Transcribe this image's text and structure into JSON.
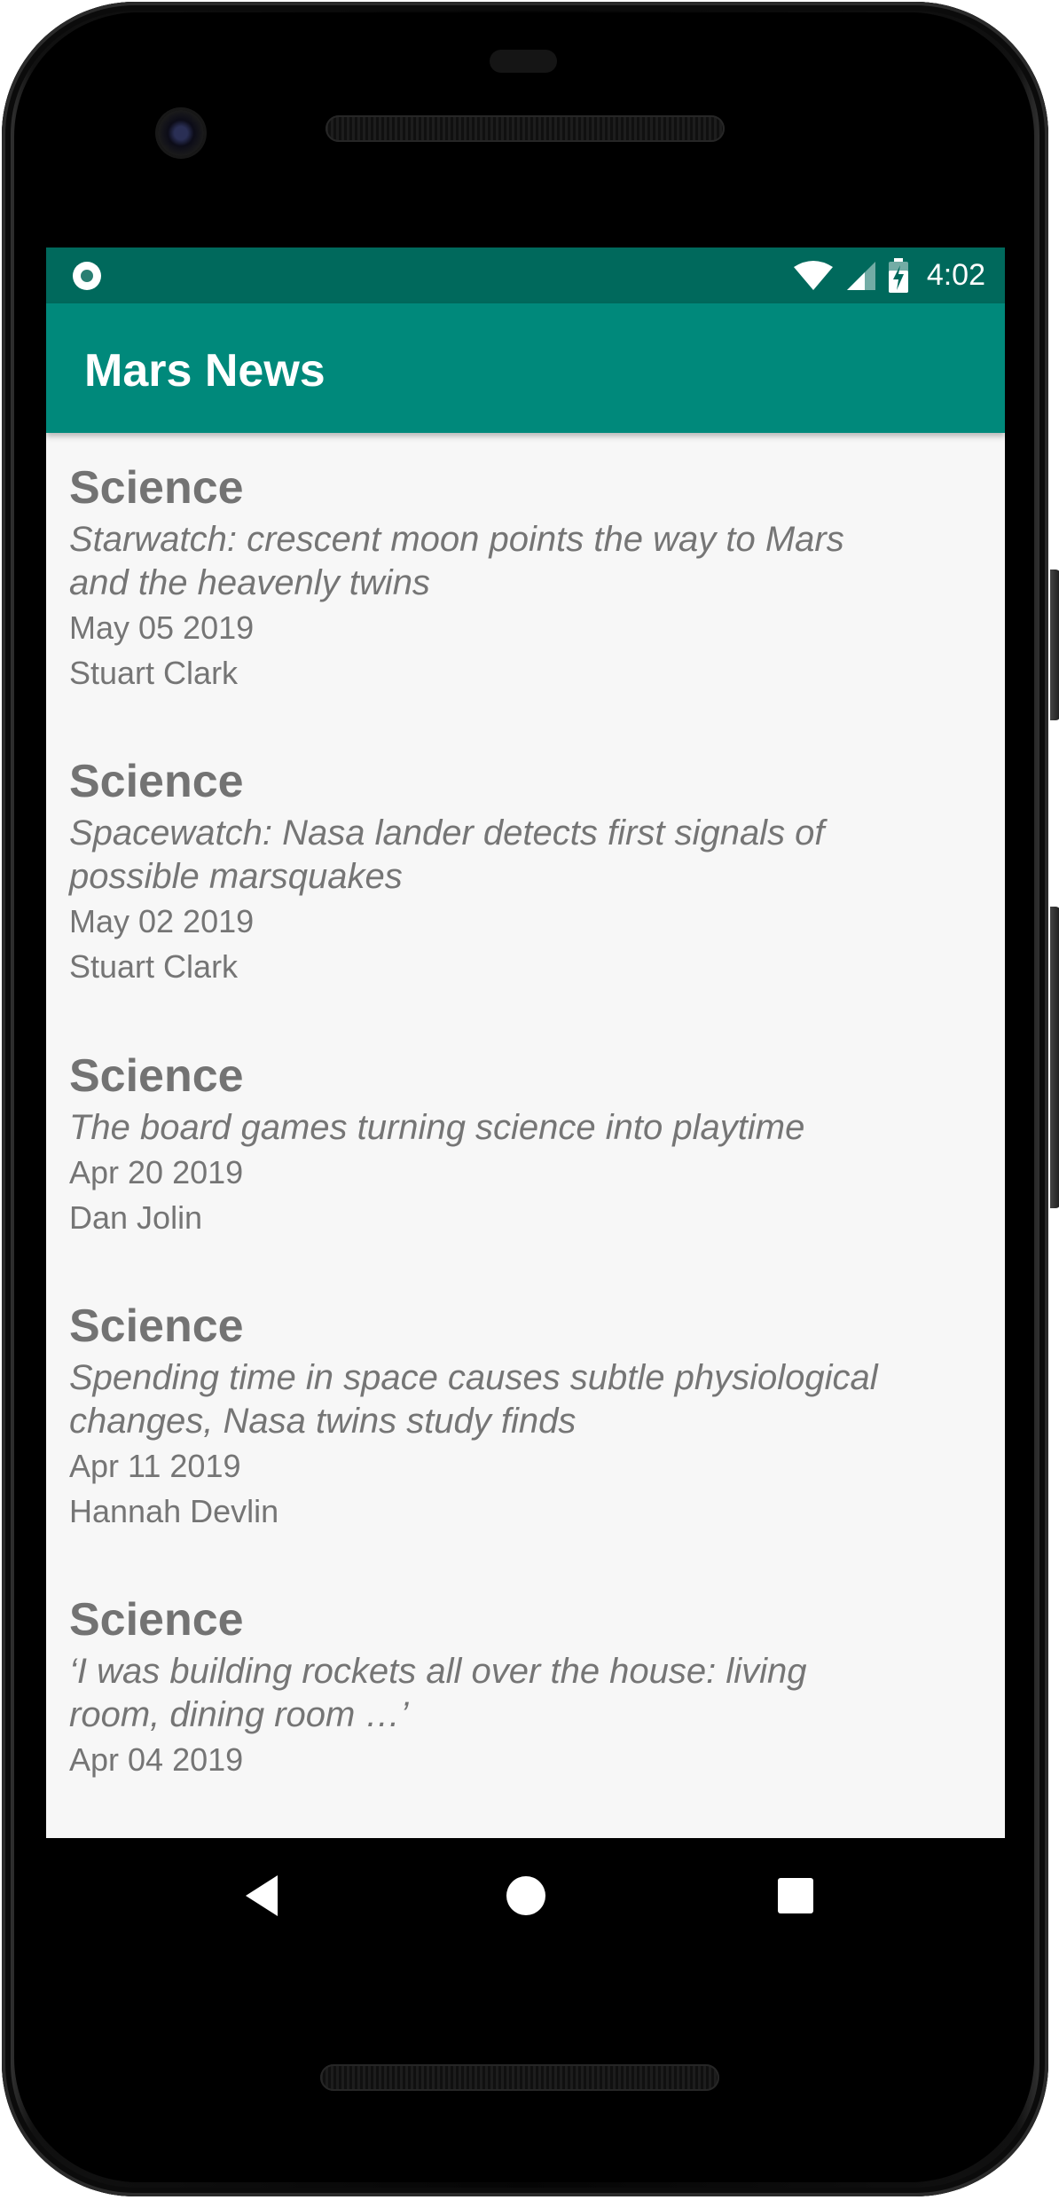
{
  "status_bar": {
    "time": "4:02",
    "background": "#00695c",
    "icons": [
      "circle-notification-icon",
      "wifi-icon",
      "cell-signal-icon",
      "battery-charging-icon"
    ]
  },
  "app_bar": {
    "title": "Mars News",
    "background": "#00897b"
  },
  "news": [
    {
      "section": "Science",
      "headline_lines": [
        "Starwatch: crescent moon points the way to Mars",
        "and the heavenly twins"
      ],
      "date": "May 05 2019",
      "author": "Stuart Clark"
    },
    {
      "section": "Science",
      "headline_lines": [
        "Spacewatch: Nasa lander detects first signals of",
        "possible marsquakes"
      ],
      "date": "May 02 2019",
      "author": "Stuart Clark"
    },
    {
      "section": "Science",
      "headline_lines": [
        "The board games turning science into playtime"
      ],
      "date": "Apr 20 2019",
      "author": "Dan Jolin"
    },
    {
      "section": "Science",
      "headline_lines": [
        "Spending time in space causes subtle physiological",
        "changes, Nasa twins study finds"
      ],
      "date": "Apr 11 2019",
      "author": "Hannah Devlin"
    },
    {
      "section": "Science",
      "headline_lines": [
        "‘I was building rockets all over the house: living",
        "room, dining room …’"
      ],
      "date": "Apr 04 2019",
      "author": ""
    }
  ],
  "nav_bar": {
    "icons": [
      "back-icon",
      "home-icon",
      "recents-icon"
    ]
  }
}
